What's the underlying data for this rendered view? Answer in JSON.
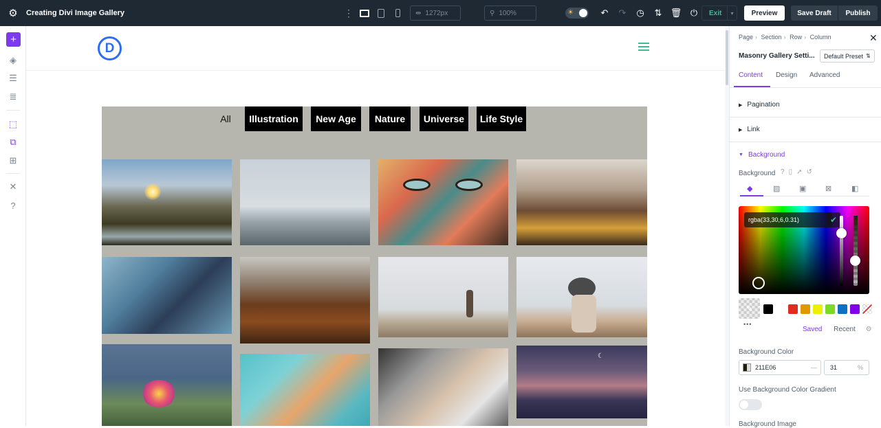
{
  "topbar": {
    "title": "Creating Divi Image Gallery",
    "width_value": "1272px",
    "zoom_value": "100%",
    "exit_label": "Exit",
    "preview_label": "Preview",
    "save_draft_label": "Save Draft",
    "publish_label": "Publish"
  },
  "gallery": {
    "filters": [
      "All",
      "Illustration",
      "New Age",
      "Nature",
      "Universe",
      "Life Style"
    ]
  },
  "panel": {
    "breadcrumb": [
      "Page",
      "Section",
      "Row",
      "Column"
    ],
    "title": "Masonry Gallery Setti...",
    "preset_label": "Default Preset",
    "tabs": [
      "Content",
      "Design",
      "Advanced"
    ],
    "sections": [
      "Pagination",
      "Link",
      "Background"
    ],
    "background_label": "Background",
    "color_value_text": "rgba(33,30,6,0.31)",
    "saved_label": "Saved",
    "recent_label": "Recent",
    "bg_color_label": "Background Color",
    "bg_color_hex": "211E06",
    "bg_color_opacity": "31",
    "opacity_unit": "%",
    "gradient_label": "Use Background Color Gradient",
    "bg_image_label": "Background Image"
  },
  "colors": {
    "accent": "#7c3aed",
    "topbar_bg": "#1f2933",
    "gallery_bg": "#b6b5ae",
    "swatches": [
      "#000000",
      "#ffffff",
      "#e02b20",
      "#e09900",
      "#edf000",
      "#7cda24",
      "#0c71c3",
      "#8300e9"
    ]
  }
}
